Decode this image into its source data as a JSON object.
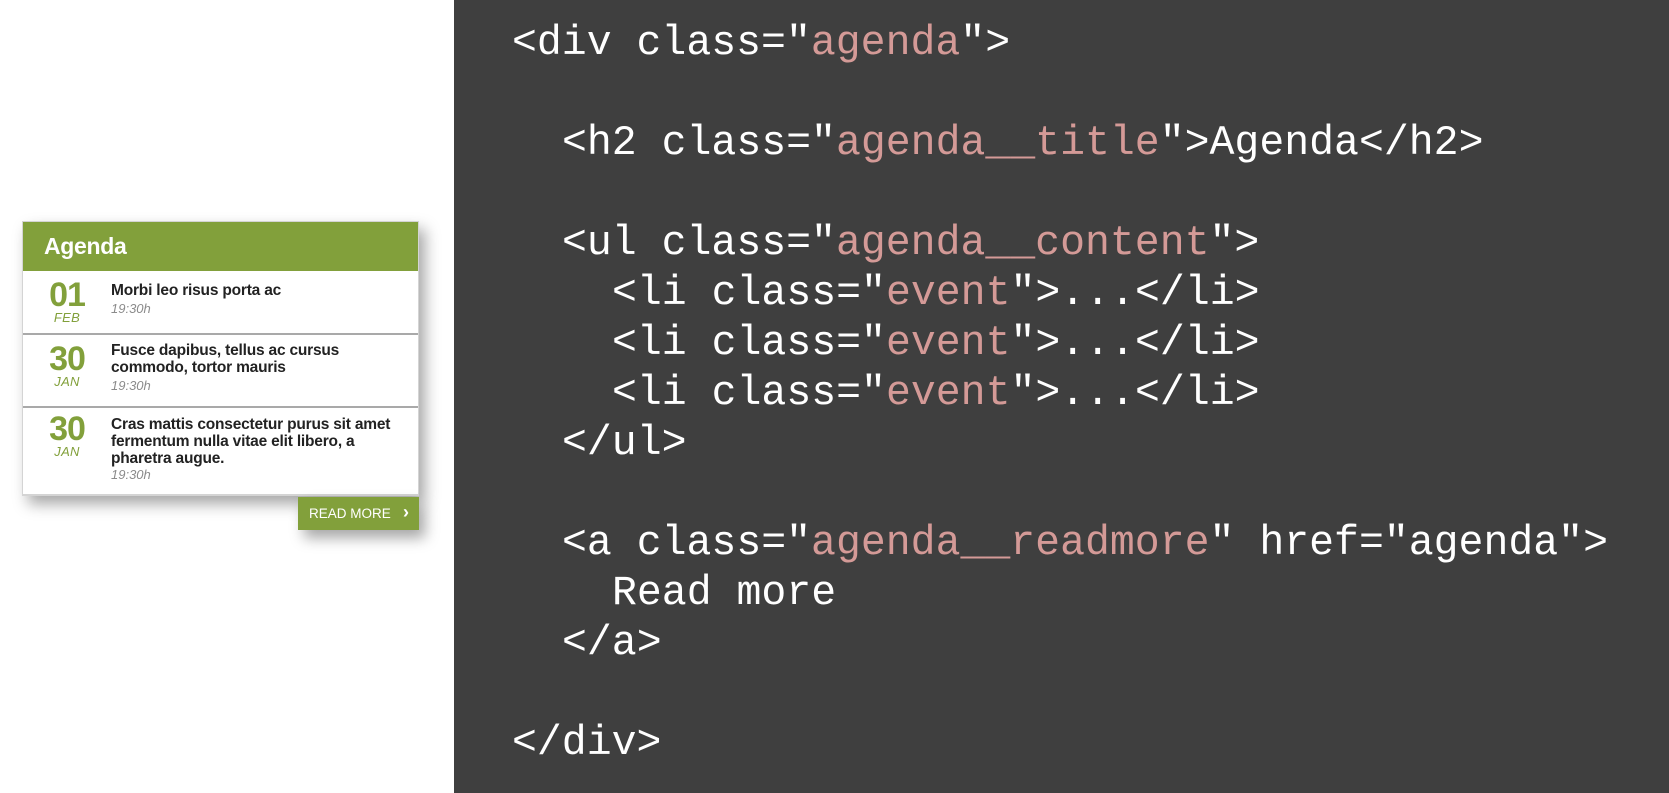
{
  "agenda": {
    "title": "Agenda",
    "events": [
      {
        "day": "01",
        "month": "FEB",
        "name": "Morbi leo risus porta ac",
        "time": "19:30h"
      },
      {
        "day": "30",
        "month": "JAN",
        "name": "Fusce dapibus, tellus ac cursus commodo, tortor mauris",
        "time": "19:30h"
      },
      {
        "day": "30",
        "month": "JAN",
        "name": "Cras mattis consectetur purus sit amet fermentum nulla vitae elit libero, a pharetra augue.",
        "time": "19:30h"
      }
    ],
    "readmore_label": "READ MORE",
    "readmore_icon": "chevron-right-icon"
  },
  "code": {
    "div_open": {
      "pre": "<div class=\"",
      "attr": "agenda",
      "post": "\">"
    },
    "h2": {
      "pre": "<h2 class=\"",
      "attr": "agenda__title",
      "post": "\">Agenda</h2>"
    },
    "ul_open": {
      "pre": "<ul class=\"",
      "attr": "agenda__content",
      "post": "\">"
    },
    "li1": {
      "pre": "<li class=\"",
      "attr": "event",
      "post": "\">...</li>"
    },
    "li2": {
      "pre": "<li class=\"",
      "attr": "event",
      "post": "\">...</li>"
    },
    "li3": {
      "pre": "<li class=\"",
      "attr": "event",
      "post": "\">...</li>"
    },
    "ul_close": "</ul>",
    "a_open": {
      "pre": "<a class=\"",
      "attr": "agenda__readmore",
      "post": "\" href=\"agenda\">"
    },
    "a_text": "Read more",
    "a_close": "</a>",
    "div_close": "</div>"
  },
  "colors": {
    "accent": "#82a03b",
    "code_background": "#3f3f3f",
    "code_attribute": "#d49a97",
    "code_text": "#ffffff"
  }
}
